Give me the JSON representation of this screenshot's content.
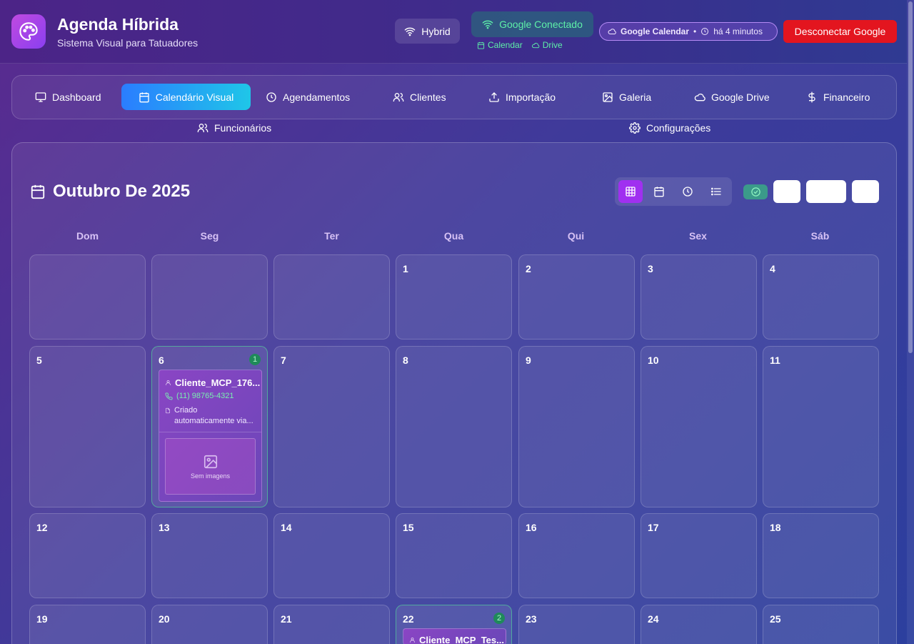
{
  "app": {
    "title": "Agenda Híbrida",
    "subtitle": "Sistema Visual para Tatuadores"
  },
  "header": {
    "mode_label": "Hybrid",
    "google_status": "Google Conectado",
    "google_services": [
      "Calendar",
      "Drive"
    ],
    "sync_service": "Google Calendar",
    "sync_separator": "•",
    "sync_time": "há 4 minutos",
    "disconnect_label": "Desconectar Google"
  },
  "nav": {
    "items": [
      {
        "label": "Dashboard",
        "icon": "monitor-icon",
        "active": false
      },
      {
        "label": "Calendário Visual",
        "icon": "calendar-icon",
        "active": true
      },
      {
        "label": "Agendamentos",
        "icon": "clock-icon",
        "active": false
      },
      {
        "label": "Clientes",
        "icon": "users-icon",
        "active": false
      },
      {
        "label": "Importação",
        "icon": "upload-icon",
        "active": false
      },
      {
        "label": "Galeria",
        "icon": "image-icon",
        "active": false
      },
      {
        "label": "Google Drive",
        "icon": "cloud-icon",
        "active": false
      },
      {
        "label": "Financeiro",
        "icon": "dollar-icon",
        "active": false
      },
      {
        "label": "Funcionários",
        "icon": "users-icon",
        "active": false
      },
      {
        "label": "Configurações",
        "icon": "gear-icon",
        "active": false
      }
    ]
  },
  "calendar": {
    "month_title": "Outubro De 2025",
    "view_modes": [
      "grid-icon",
      "calendar-icon",
      "clock-icon",
      "list-icon"
    ],
    "active_view": "grid-icon",
    "weekdays": [
      "Dom",
      "Seg",
      "Ter",
      "Qua",
      "Qui",
      "Sex",
      "Sáb"
    ],
    "weeks": [
      [
        "",
        "",
        "",
        "1",
        "2",
        "3",
        "4"
      ],
      [
        "5",
        "6",
        "7",
        "8",
        "9",
        "10",
        "11"
      ],
      [
        "12",
        "13",
        "14",
        "15",
        "16",
        "17",
        "18"
      ],
      [
        "19",
        "20",
        "21",
        "22",
        "23",
        "24",
        "25"
      ]
    ],
    "event_counts": {
      "6": "1",
      "22": "2"
    },
    "events": {
      "day_6": {
        "client": "Cliente_MCP_176...",
        "phone": "(11) 98765-4321",
        "description_line1": "Criado",
        "description_line2": "automaticamente via...",
        "images_placeholder": "Sem imagens"
      },
      "day_22": {
        "client": "Cliente_MCP_Tes..."
      }
    }
  },
  "colors": {
    "accent": "#a030f0",
    "active_tab_start": "#2a7dff",
    "active_tab_end": "#1fc6e8",
    "success": "#5ef0a8",
    "danger": "#e3151f"
  }
}
